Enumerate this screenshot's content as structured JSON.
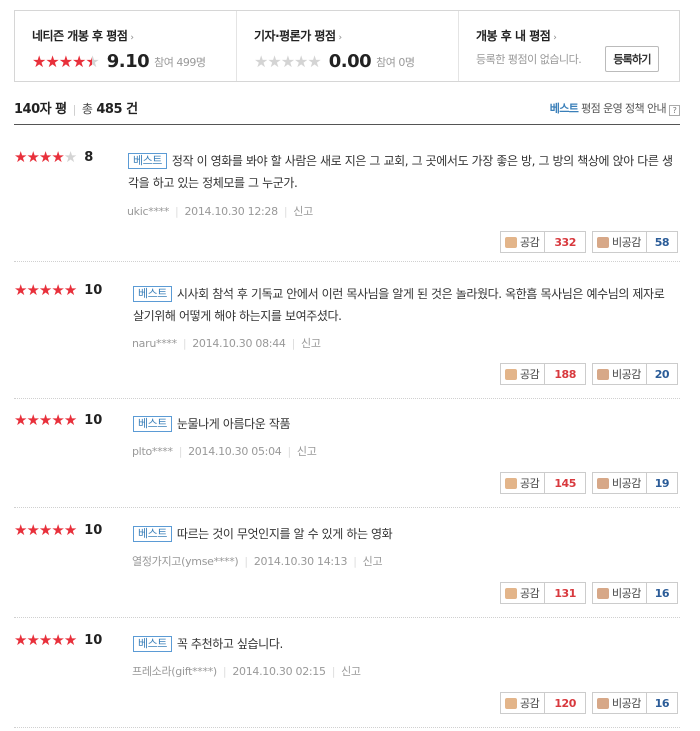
{
  "summary": {
    "netizen": {
      "title": "네티즌 개봉 후 평점",
      "score": "9.10",
      "participants": "참여 499명",
      "stars": [
        1,
        1,
        1,
        1,
        0.5
      ]
    },
    "critic": {
      "title": "기자·평론가 평점",
      "score": "0.00",
      "participants": "참여 0명",
      "stars": [
        0,
        0,
        0,
        0,
        0
      ]
    },
    "mine": {
      "title": "개봉 후 내 평점",
      "empty_text": "등록한 평점이 없습니다.",
      "register_label": "등록하기"
    },
    "arrow": "›"
  },
  "list_header": {
    "tab": "140자 평",
    "total_label": "총",
    "total_count": "485",
    "total_unit": "건",
    "policy_best": "베스트",
    "policy_text": " 평점 운영 정책 안내",
    "help": "?"
  },
  "reviews": [
    {
      "stars": [
        1,
        1,
        1,
        1,
        0
      ],
      "score": "8",
      "badge": "베스트",
      "text": "정작 이 영화를 봐야 할 사람은 새로 지은 그 교회, 그 곳에서도 가장 좋은 방, 그 방의 책상에 앉아 다른 생각을 하고 있는 정체모를 그 누군가.",
      "user": "ukic****",
      "date": "2014.10.30 12:28",
      "report": "신고",
      "like_label": "공감",
      "likes": "332",
      "dislike_label": "비공감",
      "dislikes": "58"
    },
    {
      "stars": [
        1,
        1,
        1,
        1,
        1
      ],
      "score": "10",
      "badge": "베스트",
      "text": "시사회 참석 후 기독교 안에서 이런 목사님을 알게 된 것은 놀라웠다. 옥한흠 목사님은 예수님의 제자로 살기위해 어떻게 해야 하는지를 보여주셨다.",
      "user": "naru****",
      "date": "2014.10.30 08:44",
      "report": "신고",
      "like_label": "공감",
      "likes": "188",
      "dislike_label": "비공감",
      "dislikes": "20"
    },
    {
      "stars": [
        1,
        1,
        1,
        1,
        1
      ],
      "score": "10",
      "badge": "베스트",
      "text": "눈물나게 아름다운 작품",
      "user": "plto****",
      "date": "2014.10.30 05:04",
      "report": "신고",
      "like_label": "공감",
      "likes": "145",
      "dislike_label": "비공감",
      "dislikes": "19"
    },
    {
      "stars": [
        1,
        1,
        1,
        1,
        1
      ],
      "score": "10",
      "badge": "베스트",
      "text": "따르는 것이 무엇인지를 알 수 있게 하는 영화",
      "user": "열정가지고(ymse****)",
      "date": "2014.10.30 14:13",
      "report": "신고",
      "like_label": "공감",
      "likes": "131",
      "dislike_label": "비공감",
      "dislikes": "16"
    },
    {
      "stars": [
        1,
        1,
        1,
        1,
        1
      ],
      "score": "10",
      "badge": "베스트",
      "text": "꼭 추천하고 싶습니다.",
      "user": "프레소라(gift****)",
      "date": "2014.10.30 02:15",
      "report": "신고",
      "like_label": "공감",
      "likes": "120",
      "dislike_label": "비공감",
      "dislikes": "16"
    }
  ]
}
